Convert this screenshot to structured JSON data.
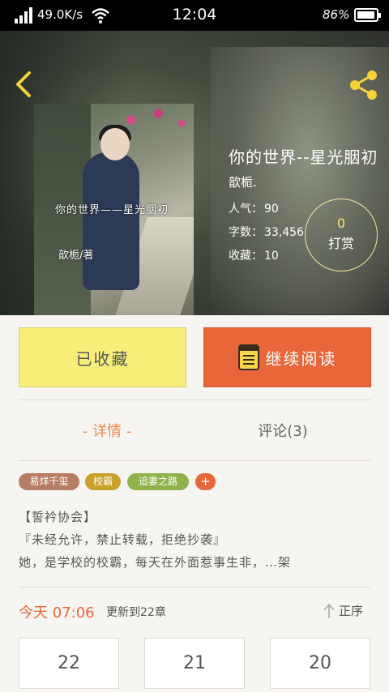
{
  "status_bar": {
    "network_speed": "49.0K/s",
    "time": "12:04",
    "battery_percent": "86%",
    "battery_level": 0.86,
    "signal_icon": "signal-icon",
    "wifi_icon": "wifi-icon"
  },
  "header": {
    "back_icon": "chevron-left-icon",
    "share_icon": "share-icon",
    "accent": "#f5d23a"
  },
  "book": {
    "title": "你的世界--星光胭初",
    "author": "歆栀.",
    "cover_title": "你的世界——星光胭初",
    "cover_author": "歆栀/著",
    "stats": [
      {
        "key": "人气：",
        "value": "90"
      },
      {
        "key": "字数：",
        "value": "33,456"
      },
      {
        "key": "收藏：",
        "value": "10"
      }
    ],
    "tip": {
      "count": "0",
      "label": "打赏"
    }
  },
  "actions": {
    "collected_label": "已收藏",
    "read_label": "继续阅读",
    "collected_color": "#f8ef7a",
    "read_color": "#e8663a"
  },
  "tabs": [
    {
      "label": "- 详情 -",
      "active": true
    },
    {
      "label": "评论(3)",
      "active": false
    }
  ],
  "tags": [
    {
      "label": "易烊千玺",
      "color": "#b77c64"
    },
    {
      "label": "校霸",
      "color": "#c9a12c"
    },
    {
      "label": "追妻之路",
      "color": "#8fb24c"
    }
  ],
  "tag_add_label": "+",
  "description": [
    "【誓衿协会】",
    "『未经允许，禁止转载，拒绝抄袭』",
    "她，是学校的校霸，每天在外面惹事生非，…架"
  ],
  "update": {
    "today": "今天 07:06",
    "text": "更新到22章",
    "sort_label": "正序"
  },
  "chapters": [
    "22",
    "21",
    "20"
  ]
}
